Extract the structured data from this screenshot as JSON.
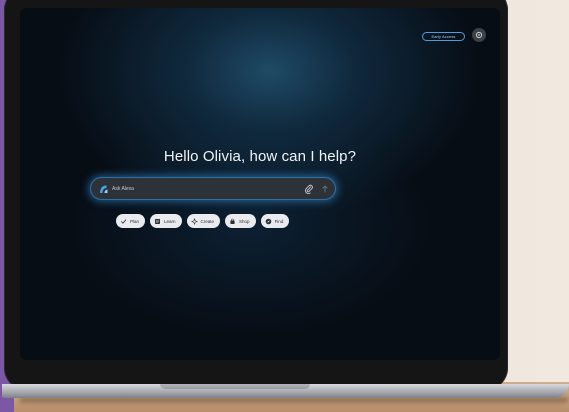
{
  "header": {
    "pill_label": "Early Access",
    "settings_icon": "gear-icon"
  },
  "main": {
    "greeting": "Hello Olivia, how can I help?",
    "prompt": {
      "placeholder": "Ask Alexa",
      "alexa_icon": "alexa-icon",
      "attach_icon": "paperclip-icon",
      "send_icon": "send-arrow-icon"
    },
    "chips": [
      {
        "label": "Plan",
        "icon": "check-icon"
      },
      {
        "label": "Learn",
        "icon": "book-icon"
      },
      {
        "label": "Create",
        "icon": "sparkle-icon"
      },
      {
        "label": "Shop",
        "icon": "bag-icon"
      },
      {
        "label": "Find",
        "icon": "compass-icon"
      }
    ]
  },
  "colors": {
    "accent": "#4f9cd8",
    "screen_bg": "#070d15",
    "chip_bg": "#e9ebee"
  }
}
